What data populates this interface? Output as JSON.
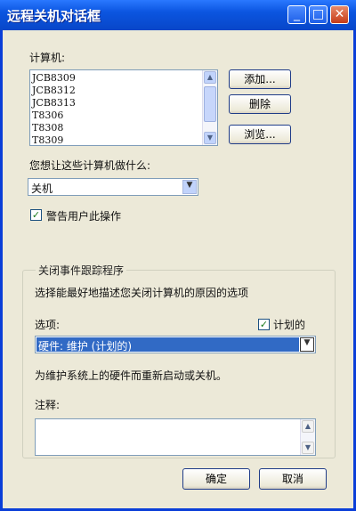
{
  "window": {
    "title": "远程关机对话框"
  },
  "titlebar_buttons": {
    "minimize": "_",
    "maximize": "□",
    "close": "✕"
  },
  "computers": {
    "label": "计算机:",
    "items": [
      "JCB8309",
      "JCB8312",
      "JCB8313",
      "T8306",
      "T8308",
      "T8309"
    ]
  },
  "buttons": {
    "add": "添加...",
    "remove": "删除",
    "browse": "浏览...",
    "ok": "确定",
    "cancel": "取消"
  },
  "action": {
    "label": "您想让这些计算机做什么:",
    "selected": "关机"
  },
  "warn_users": {
    "label": "警告用户此操作",
    "checked": true
  },
  "shutdown_tracker": {
    "legend": "关闭事件跟踪程序",
    "description": "选择能最好地描述您关闭计算机的原因的选项",
    "options_label": "选项:",
    "planned_label": "计划的",
    "planned_checked": true,
    "option_selected": "硬件: 维护 (计划的)",
    "option_description": "为维护系统上的硬件而重新启动或关机。",
    "comment_label": "注释:",
    "comment_value": ""
  },
  "colors": {
    "titlebar": "#0b55e0",
    "dialog_bg": "#ece9d8",
    "selection": "#316ac5"
  }
}
